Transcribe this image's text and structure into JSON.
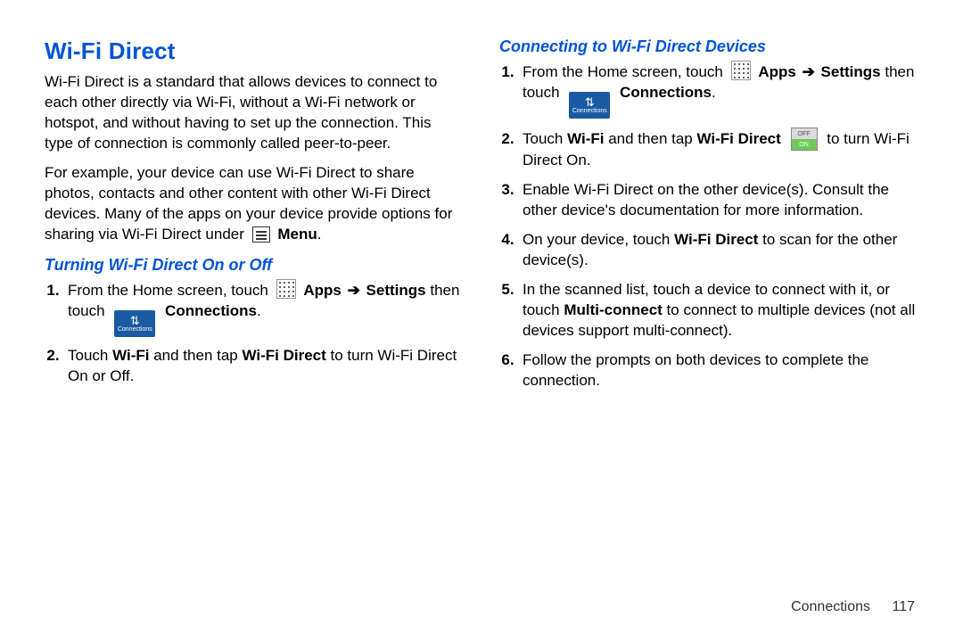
{
  "heading": "Wi-Fi Direct",
  "intro": {
    "p1": "Wi-Fi Direct is a standard that allows devices to connect to each other directly via Wi-Fi, without a Wi-Fi network or hotspot, and without having to set up the connection. This type of connection is commonly called peer-to-peer.",
    "p2_a": "For example, your device can use Wi-Fi Direct to share photos, contacts and other content with other Wi-Fi Direct devices. Many of the apps on your device provide options for sharing via Wi-Fi Direct under ",
    "menu_label": "Menu",
    "p2_b": "."
  },
  "subheading_left": "Turning Wi-Fi Direct On or Off",
  "left_steps": {
    "s1_a": "From the Home screen, touch ",
    "s1_apps": "Apps",
    "s1_b": " ",
    "s1_settings": "Settings",
    "s1_c": " then touch ",
    "s1_connections": "Connections",
    "s1_d": ".",
    "s2_a": "Touch ",
    "s2_wifi": "Wi-Fi",
    "s2_b": " and then tap ",
    "s2_wfd": "Wi-Fi Direct",
    "s2_c": " to turn Wi-Fi Direct On or Off."
  },
  "subheading_right": "Connecting to Wi-Fi Direct Devices",
  "right_steps": {
    "s1_a": "From the Home screen, touch ",
    "s1_apps": "Apps",
    "s1_b": " ",
    "s1_settings": "Settings",
    "s1_c": " then touch ",
    "s1_connections": "Connections",
    "s1_d": ".",
    "s2_a": "Touch ",
    "s2_wifi": "Wi-Fi",
    "s2_b": " and then tap ",
    "s2_wfd": "Wi-Fi Direct",
    "s2_c": " to turn Wi-Fi Direct On.",
    "s3": "Enable Wi-Fi Direct on the other device(s). Consult the other device's documentation for more information.",
    "s4_a": "On your device, touch ",
    "s4_wfd": "Wi-Fi Direct",
    "s4_b": " to scan for the other device(s).",
    "s5_a": "In the scanned list, touch a device to connect with it, or touch ",
    "s5_mc": "Multi-connect",
    "s5_b": " to connect to multiple devices (not all devices support multi-connect).",
    "s6": "Follow the prompts on both devices to complete the connection."
  },
  "icon_labels": {
    "connections_text": "Connections",
    "arrow": "➔"
  },
  "footer": {
    "section": "Connections",
    "page": "117"
  }
}
